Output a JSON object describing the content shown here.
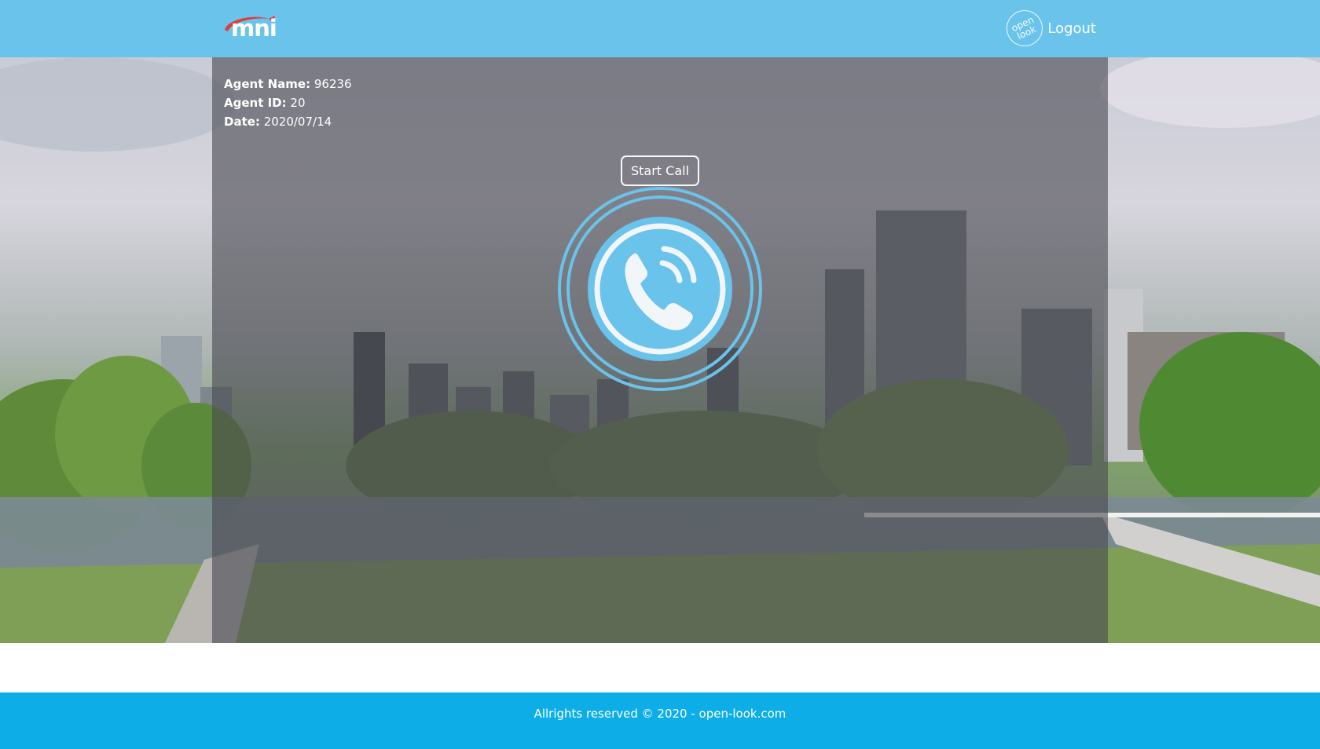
{
  "header": {
    "brand": "mni",
    "avatar_text": "open look",
    "logout_label": "Logout"
  },
  "agent": {
    "name_label": "Agent Name:",
    "name_value": "96236",
    "id_label": "Agent ID:",
    "id_value": "20",
    "date_label": "Date:",
    "date_value": "2020/07/14"
  },
  "call": {
    "start_label": "Start Call"
  },
  "footer": {
    "copyright": "Allrights reserved © 2020 - open-look.com"
  },
  "colors": {
    "header_bg": "#6ac3ea",
    "footer_bg": "#0daee8",
    "phone_blue": "#6ac3ea",
    "logo_red": "#e23b3b"
  },
  "icons": {
    "phone": "phone-icon",
    "logo": "mni-logo",
    "avatar": "open-look-avatar"
  }
}
